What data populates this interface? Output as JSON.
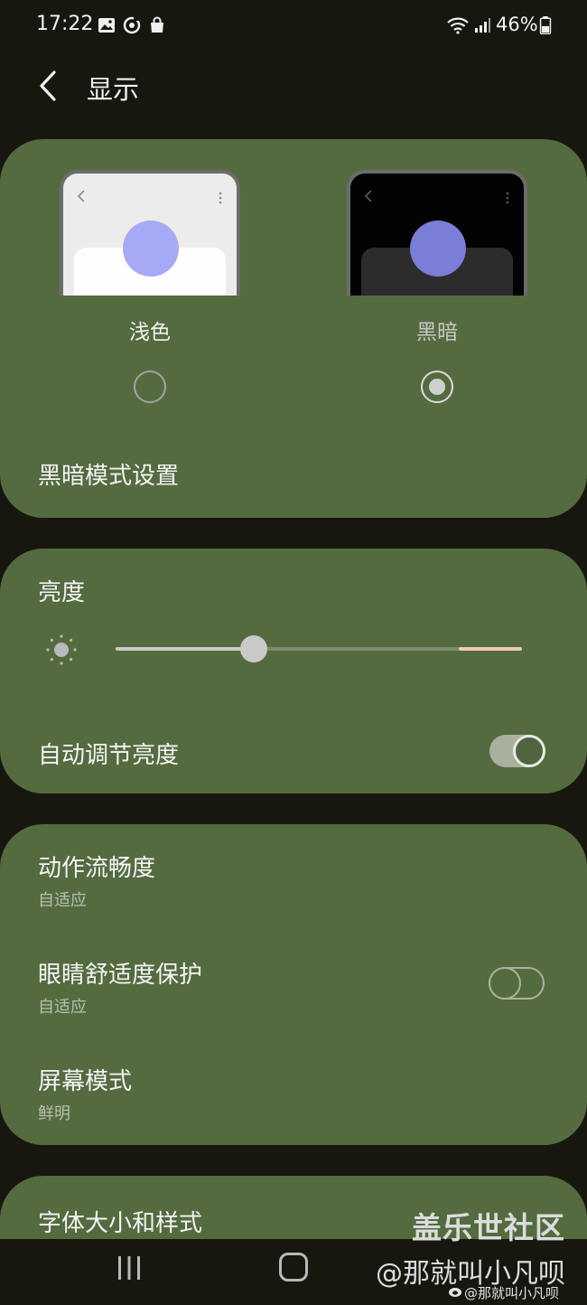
{
  "status_bar": {
    "time": "17:22",
    "battery": "46%",
    "left_icons": [
      "gallery-icon",
      "sync-icon",
      "shopping-bag-icon"
    ],
    "right_icons": [
      "wifi-icon",
      "signal-icon",
      "battery-icon"
    ]
  },
  "header": {
    "title": "显示",
    "back_icon": "chevron-left-icon"
  },
  "theme": {
    "light_label": "浅色",
    "dark_label": "黑暗",
    "selected": "dark"
  },
  "dark_mode_settings": "黑暗模式设置",
  "brightness": {
    "label": "亮度",
    "level_percent": 34,
    "auto_label": "自动调节亮度",
    "auto_enabled": true
  },
  "items": [
    {
      "title": "动作流畅度",
      "subtitle": "自适应"
    },
    {
      "title": "眼睛舒适度保护",
      "subtitle": "自适应",
      "toggle": false
    },
    {
      "title": "屏幕模式",
      "subtitle": "鲜明"
    }
  ],
  "font_size_style": "字体大小和样式",
  "nav": {
    "recent_icon": "recent-apps-icon",
    "home_icon": "home-icon"
  },
  "watermark": {
    "line1": "盖乐世社区",
    "line2": "@那就叫小凡呗",
    "line3": "@那就叫小凡呗"
  },
  "colors": {
    "background": "#18170f",
    "card": "#546b40",
    "accent_preview": "#a6aaf6"
  }
}
